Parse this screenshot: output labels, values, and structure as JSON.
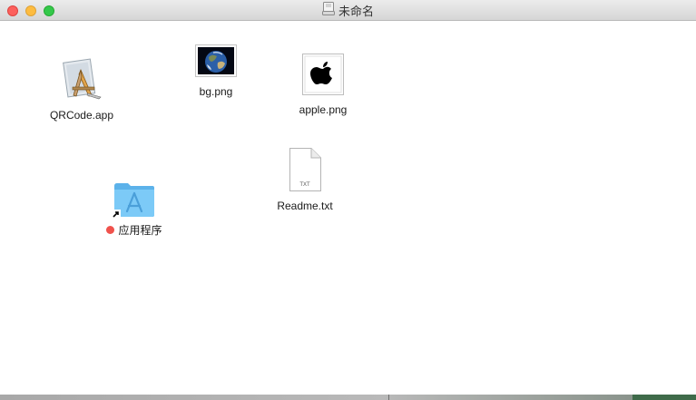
{
  "window": {
    "title": "未命名",
    "title_icon": "disk-image-icon"
  },
  "colors": {
    "close": "#fc605c",
    "minimize": "#fdbc40",
    "zoom": "#34c84a",
    "tag_red": "#f0524c",
    "folder_blue": "#6ec2f5"
  },
  "items": {
    "qrcode_app": {
      "name": "QRCode.app",
      "icon": "application-icon"
    },
    "bg_png": {
      "name": "bg.png",
      "icon": "earth-image-thumbnail-icon"
    },
    "apple_png": {
      "name": "apple.png",
      "icon": "apple-logo-thumbnail-icon"
    },
    "readme_txt": {
      "name": "Readme.txt",
      "icon": "text-document-icon",
      "badge": "TXT"
    },
    "applications": {
      "name": "应用程序",
      "icon": "applications-folder-alias-icon",
      "tag": "red"
    }
  }
}
